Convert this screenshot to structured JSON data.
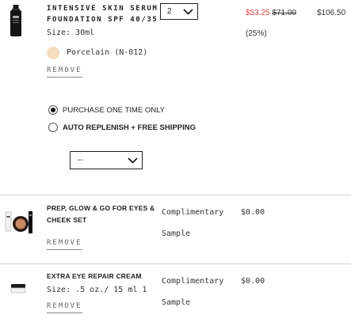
{
  "items": [
    {
      "name_line1": "INTENSIVE SKIN SERUM",
      "name_line2": "FOUNDATION SPF 40/35",
      "size": "Size: 30ml",
      "shade": "Porcelain (N-012)",
      "shade_color": "#f6dcc0",
      "quantity": "2",
      "sale_price": "$53.25",
      "original_price": "$71.00",
      "discount": "(25%)",
      "total": "$106.50",
      "remove": "REMOVE",
      "purchase_options": [
        "PURCHASE ONE TIME ONLY",
        "AUTO REPLENISH + FREE SHIPPING"
      ],
      "purchase_selected": "PURCHASE ONE TIME ONLY",
      "frequency_value": "--"
    },
    {
      "name_line1": "PREP, GLOW & GO FOR EYES &",
      "name_line2": "CHEEK SET",
      "label_line1": "Complimentary",
      "label_line2": "Sample",
      "price": "$0.00",
      "remove": "REMOVE"
    },
    {
      "name_line1": "EXTRA EYE REPAIR CREAM",
      "size": "Size: .5 oz./ 15 ml 1",
      "label_line1": "Complimentary",
      "label_line2": "Sample",
      "price": "$0.00",
      "remove": "REMOVE"
    }
  ],
  "colors": {
    "sale": "#e0434a",
    "divider": "#cfcfcf"
  }
}
